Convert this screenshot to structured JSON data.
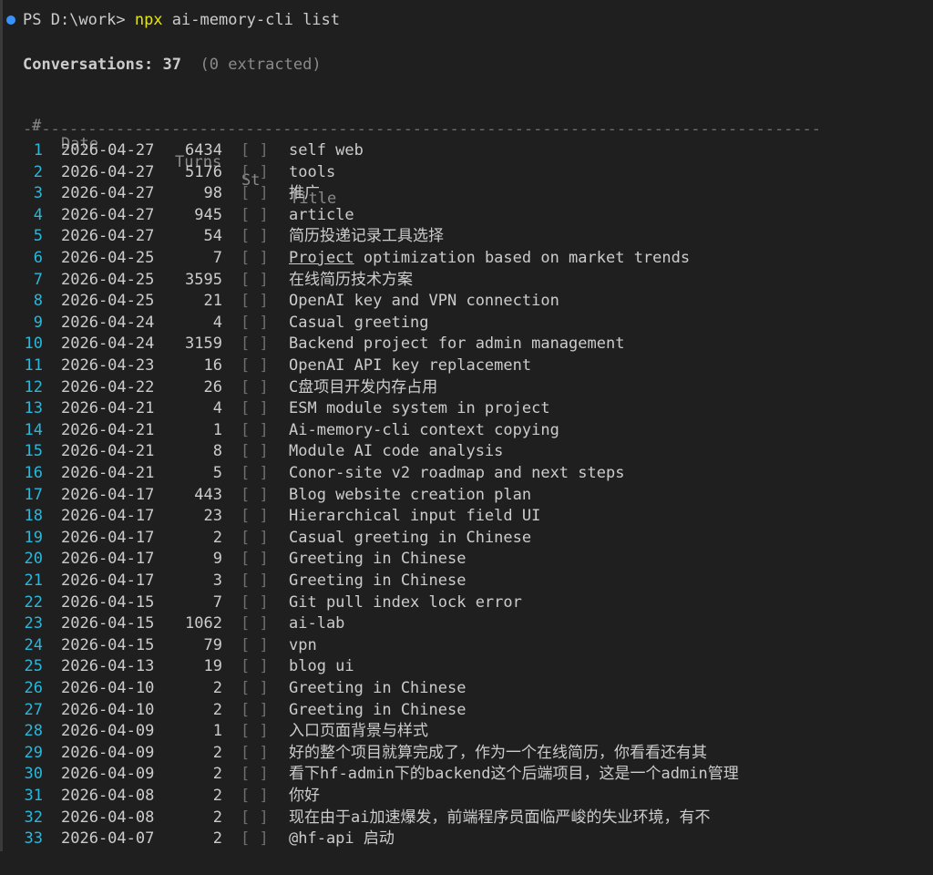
{
  "prompt": {
    "path": "PS D:\\work> ",
    "command": "npx",
    "args": " ai-memory-cli list"
  },
  "summary": {
    "label": "Conversations:",
    "count": "37",
    "extra": "(0 extracted)"
  },
  "header": {
    "num": "#",
    "date": "Date",
    "turns": "Turns",
    "st": "St",
    "title": "Title"
  },
  "separator": "--------------------------------------------------------------------------------------",
  "rows": [
    {
      "num": "1",
      "date": "2026-04-27",
      "turns": "6434",
      "st": "[ ]",
      "title": "self web"
    },
    {
      "num": "2",
      "date": "2026-04-27",
      "turns": "5176",
      "st": "[ ]",
      "title": "tools"
    },
    {
      "num": "3",
      "date": "2026-04-27",
      "turns": "98",
      "st": "[ ]",
      "title": "推广"
    },
    {
      "num": "4",
      "date": "2026-04-27",
      "turns": "945",
      "st": "[ ]",
      "title": "article"
    },
    {
      "num": "5",
      "date": "2026-04-27",
      "turns": "54",
      "st": "[ ]",
      "title": "简历投递记录工具选择"
    },
    {
      "num": "6",
      "date": "2026-04-25",
      "turns": "7",
      "st": "[ ]",
      "title": "Project optimization based on market trends"
    },
    {
      "num": "7",
      "date": "2026-04-25",
      "turns": "3595",
      "st": "[ ]",
      "title": "在线简历技术方案"
    },
    {
      "num": "8",
      "date": "2026-04-25",
      "turns": "21",
      "st": "[ ]",
      "title": "OpenAI key and VPN connection"
    },
    {
      "num": "9",
      "date": "2026-04-24",
      "turns": "4",
      "st": "[ ]",
      "title": "Casual greeting"
    },
    {
      "num": "10",
      "date": "2026-04-24",
      "turns": "3159",
      "st": "[ ]",
      "title": "Backend project for admin management"
    },
    {
      "num": "11",
      "date": "2026-04-23",
      "turns": "16",
      "st": "[ ]",
      "title": "OpenAI API key replacement"
    },
    {
      "num": "12",
      "date": "2026-04-22",
      "turns": "26",
      "st": "[ ]",
      "title": "C盘项目开发内存占用"
    },
    {
      "num": "13",
      "date": "2026-04-21",
      "turns": "4",
      "st": "[ ]",
      "title": "ESM module system in project"
    },
    {
      "num": "14",
      "date": "2026-04-21",
      "turns": "1",
      "st": "[ ]",
      "title": "Ai-memory-cli context copying"
    },
    {
      "num": "15",
      "date": "2026-04-21",
      "turns": "8",
      "st": "[ ]",
      "title": "Module AI code analysis"
    },
    {
      "num": "16",
      "date": "2026-04-21",
      "turns": "5",
      "st": "[ ]",
      "title": "Conor-site v2 roadmap and next steps"
    },
    {
      "num": "17",
      "date": "2026-04-17",
      "turns": "443",
      "st": "[ ]",
      "title": "Blog website creation plan"
    },
    {
      "num": "18",
      "date": "2026-04-17",
      "turns": "23",
      "st": "[ ]",
      "title": "Hierarchical input field UI"
    },
    {
      "num": "19",
      "date": "2026-04-17",
      "turns": "2",
      "st": "[ ]",
      "title": "Casual greeting in Chinese"
    },
    {
      "num": "20",
      "date": "2026-04-17",
      "turns": "9",
      "st": "[ ]",
      "title": "Greeting in Chinese"
    },
    {
      "num": "21",
      "date": "2026-04-17",
      "turns": "3",
      "st": "[ ]",
      "title": "Greeting in Chinese"
    },
    {
      "num": "22",
      "date": "2026-04-15",
      "turns": "7",
      "st": "[ ]",
      "title": "Git pull index lock error"
    },
    {
      "num": "23",
      "date": "2026-04-15",
      "turns": "1062",
      "st": "[ ]",
      "title": "ai-lab"
    },
    {
      "num": "24",
      "date": "2026-04-15",
      "turns": "79",
      "st": "[ ]",
      "title": "vpn"
    },
    {
      "num": "25",
      "date": "2026-04-13",
      "turns": "19",
      "st": "[ ]",
      "title": "blog ui"
    },
    {
      "num": "26",
      "date": "2026-04-10",
      "turns": "2",
      "st": "[ ]",
      "title": "Greeting in Chinese"
    },
    {
      "num": "27",
      "date": "2026-04-10",
      "turns": "2",
      "st": "[ ]",
      "title": "Greeting in Chinese"
    },
    {
      "num": "28",
      "date": "2026-04-09",
      "turns": "1",
      "st": "[ ]",
      "title": "入口页面背景与样式"
    },
    {
      "num": "29",
      "date": "2026-04-09",
      "turns": "2",
      "st": "[ ]",
      "title": "好的整个项目就算完成了，作为一个在线简历，你看看还有其"
    },
    {
      "num": "30",
      "date": "2026-04-09",
      "turns": "2",
      "st": "[ ]",
      "title": "看下hf-admin下的backend这个后端项目，这是一个admin管理"
    },
    {
      "num": "31",
      "date": "2026-04-08",
      "turns": "2",
      "st": "[ ]",
      "title": "你好"
    },
    {
      "num": "32",
      "date": "2026-04-08",
      "turns": "2",
      "st": "[ ]",
      "title": "现在由于ai加速爆发，前端程序员面临严峻的失业环境，有不"
    },
    {
      "num": "33",
      "date": "2026-04-07",
      "turns": "2",
      "st": "[ ]",
      "title": "@hf-api 启动"
    }
  ]
}
